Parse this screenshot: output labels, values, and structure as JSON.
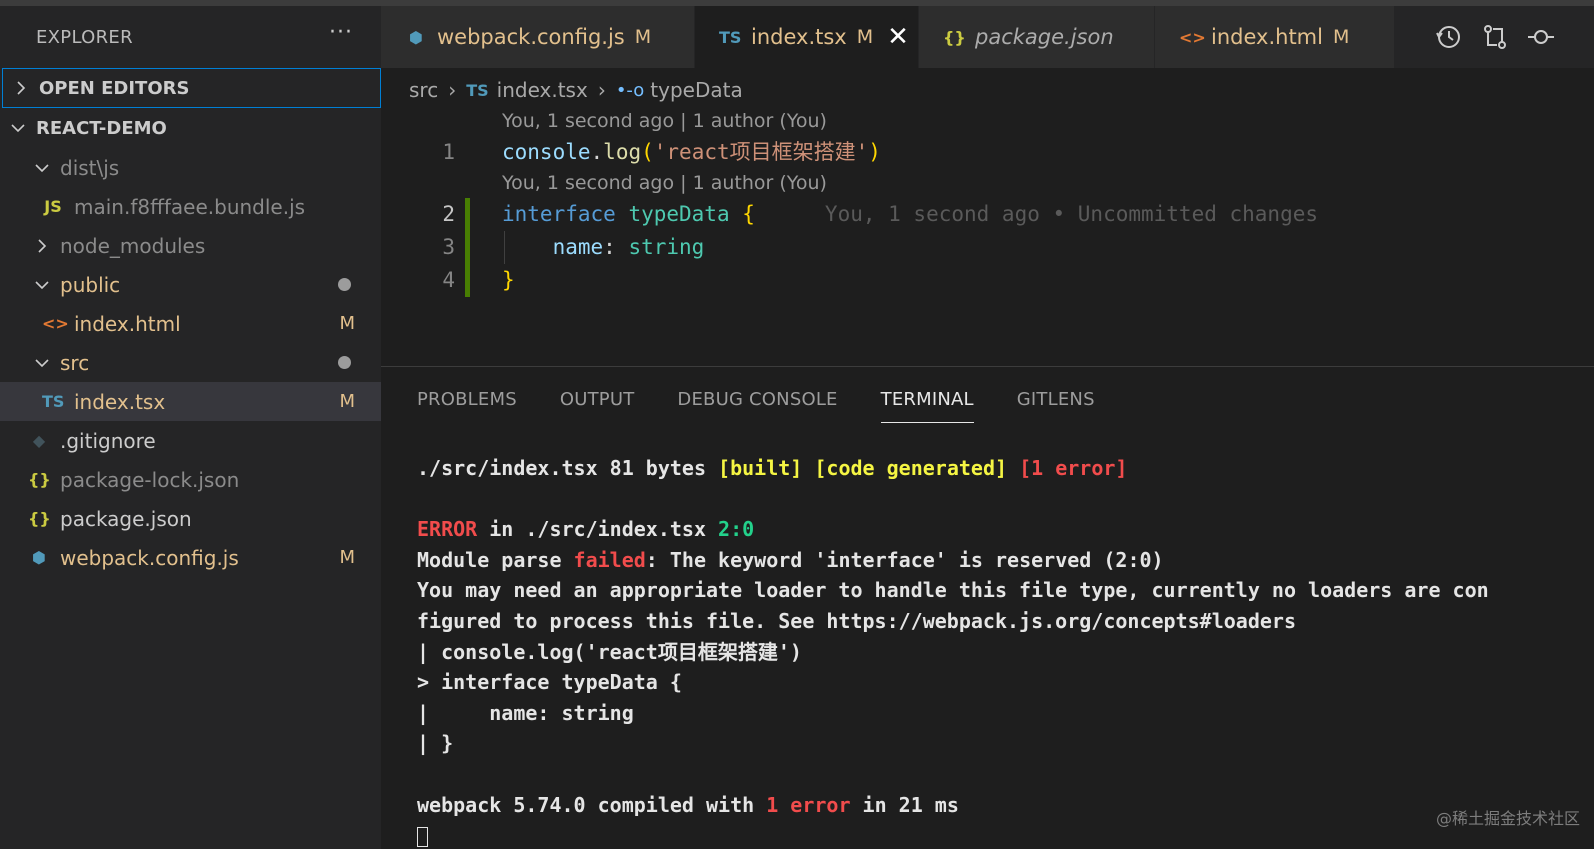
{
  "sidebar": {
    "title": "EXPLORER",
    "more": "···",
    "open_editors": "OPEN EDITORS",
    "project": "REACT-DEMO",
    "items": [
      {
        "label": "dist\\js",
        "type": "folder",
        "expanded": true
      },
      {
        "label": "main.f8fffaee.bundle.js",
        "type": "file",
        "icon": "js-file-icon",
        "icon_text": "JS"
      },
      {
        "label": "node_modules",
        "type": "folder",
        "expanded": false
      },
      {
        "label": "public",
        "type": "folder",
        "expanded": true,
        "modified_dot": true
      },
      {
        "label": "index.html",
        "type": "file",
        "icon": "html-file-icon",
        "icon_text": "<>",
        "decoration": "M"
      },
      {
        "label": "src",
        "type": "folder",
        "expanded": true,
        "modified_dot": true
      },
      {
        "label": "index.tsx",
        "type": "file",
        "icon": "ts-file-icon",
        "icon_text": "TS",
        "decoration": "M",
        "selected": true
      },
      {
        "label": ".gitignore",
        "type": "file",
        "icon": "git-file-icon",
        "icon_text": "◆"
      },
      {
        "label": "package-lock.json",
        "type": "file",
        "icon": "json-file-icon",
        "icon_text": "{}"
      },
      {
        "label": "package.json",
        "type": "file",
        "icon": "json-file-icon",
        "icon_text": "{}"
      },
      {
        "label": "webpack.config.js",
        "type": "file",
        "icon": "webpack-file-icon",
        "icon_text": "⬢",
        "decoration": "M"
      }
    ]
  },
  "tabs": [
    {
      "label": "webpack.config.js",
      "icon_text": "⬢",
      "mod": "M"
    },
    {
      "label": "index.tsx",
      "icon_text": "TS",
      "mod": "M",
      "close": "✕"
    },
    {
      "label": "package.json",
      "icon_text": "{}"
    },
    {
      "label": "index.html",
      "icon_text": "<>",
      "mod": "M"
    }
  ],
  "breadcrumb": {
    "folder": "src",
    "file_icon": "TS",
    "file": "index.tsx",
    "symbol_icon": "•-o",
    "symbol": "typeData"
  },
  "code": {
    "lens1": "You, 1 second ago | 1 author (You)",
    "lens2": "You, 1 second ago | 1 author (You)",
    "line_numbers": [
      "1",
      "2",
      "3",
      "4"
    ],
    "l1": {
      "obj": "console",
      "dot": ".",
      "fn": "log",
      "open": "(",
      "str": "'react项目框架搭建'",
      "close": ")"
    },
    "l2": {
      "kw": "interface",
      "name": "typeData",
      "brace": "{",
      "blame": "You, 1 second ago • Uncommitted changes"
    },
    "l3": {
      "prop": "name",
      "colon": ":",
      "type": "string"
    },
    "l4": {
      "brace": "}"
    }
  },
  "panel": {
    "tabs": [
      "PROBLEMS",
      "OUTPUT",
      "DEBUG CONSOLE",
      "TERMINAL",
      "GITLENS"
    ],
    "active_tab": "TERMINAL",
    "terminal": {
      "l1a": "./src/index.tsx 81 bytes ",
      "l1b": "[built]",
      "l1c": " ",
      "l1d": "[code generated]",
      "l1e": " ",
      "l1f": "[1 error]",
      "l2a": "ERROR",
      "l2b": " in ./src/index.tsx ",
      "l2c": "2:0",
      "l3a": "Module parse ",
      "l3b": "failed",
      "l3c": ": The keyword 'interface' is reserved (2:0)",
      "l4": "You may need an appropriate loader to handle this file type, currently no loaders are con",
      "l5": "figured to process this file. See https://webpack.js.org/concepts#loaders",
      "l6": "| console.log('react项目框架搭建')",
      "l7": "> interface typeData {",
      "l8": "|     name: string",
      "l9": "| }",
      "l10a": "webpack 5.74.0 compiled with ",
      "l10b": "1 error",
      "l10c": " in 21 ms"
    }
  },
  "watermark": "@稀土掘金技术社区",
  "colors": {
    "accent": "#007fd4",
    "modified": "#e2c08d",
    "error": "#f14c4c",
    "warning": "#f5f543",
    "success": "#23d18b"
  }
}
